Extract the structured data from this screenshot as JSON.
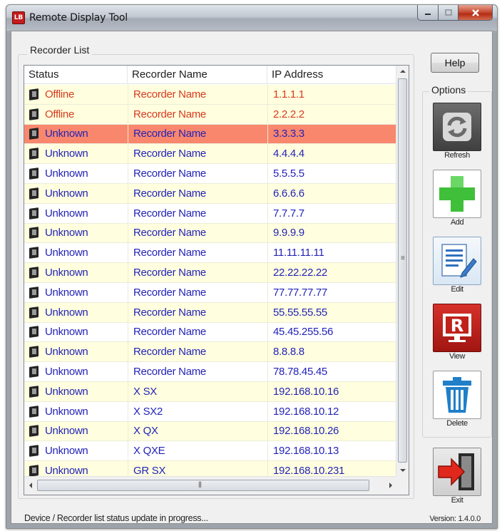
{
  "window": {
    "title": "Remote Display Tool",
    "app_icon_text": "LB"
  },
  "recorder_list": {
    "group_label": "Recorder List",
    "columns": [
      "Status",
      "Recorder Name",
      "IP Address"
    ],
    "rows": [
      {
        "status": "Offline",
        "name": "Recorder Name",
        "ip": "1.1.1.1",
        "state": "offline",
        "alt": true
      },
      {
        "status": "Offline",
        "name": "Recorder Name",
        "ip": "2.2.2.2",
        "state": "offline",
        "alt": true
      },
      {
        "status": "Unknown",
        "name": "Recorder Name",
        "ip": "3.3.3.3",
        "state": "unknown",
        "alt": false,
        "selected": true
      },
      {
        "status": "Unknown",
        "name": "Recorder Name",
        "ip": "4.4.4.4",
        "state": "unknown",
        "alt": true
      },
      {
        "status": "Unknown",
        "name": "Recorder Name",
        "ip": "5.5.5.5",
        "state": "unknown",
        "alt": false
      },
      {
        "status": "Unknown",
        "name": "Recorder Name",
        "ip": "6.6.6.6",
        "state": "unknown",
        "alt": true
      },
      {
        "status": "Unknown",
        "name": "Recorder Name",
        "ip": "7.7.7.7",
        "state": "unknown",
        "alt": false
      },
      {
        "status": "Unknown",
        "name": "Recorder Name",
        "ip": "9.9.9.9",
        "state": "unknown",
        "alt": true
      },
      {
        "status": "Unknown",
        "name": "Recorder Name",
        "ip": "11.11.11.11",
        "state": "unknown",
        "alt": false
      },
      {
        "status": "Unknown",
        "name": "Recorder Name",
        "ip": "22.22.22.22",
        "state": "unknown",
        "alt": true
      },
      {
        "status": "Unknown",
        "name": "Recorder Name",
        "ip": "77.77.77.77",
        "state": "unknown",
        "alt": false
      },
      {
        "status": "Unknown",
        "name": "Recorder Name",
        "ip": "55.55.55.55",
        "state": "unknown",
        "alt": true
      },
      {
        "status": "Unknown",
        "name": "Recorder Name",
        "ip": "45.45.255.56",
        "state": "unknown",
        "alt": false
      },
      {
        "status": "Unknown",
        "name": "Recorder Name",
        "ip": "8.8.8.8",
        "state": "unknown",
        "alt": true
      },
      {
        "status": "Unknown",
        "name": "Recorder Name",
        "ip": "78.78.45.45",
        "state": "unknown",
        "alt": false
      },
      {
        "status": "Unknown",
        "name": "X SX",
        "ip": "192.168.10.16",
        "state": "unknown",
        "alt": true
      },
      {
        "status": "Unknown",
        "name": "X SX2",
        "ip": "192.168.10.12",
        "state": "unknown",
        "alt": false
      },
      {
        "status": "Unknown",
        "name": "X QX",
        "ip": "192.168.10.26",
        "state": "unknown",
        "alt": true
      },
      {
        "status": "Unknown",
        "name": "X QXE",
        "ip": "192.168.10.13",
        "state": "unknown",
        "alt": false
      },
      {
        "status": "Unknown",
        "name": "GR SX",
        "ip": "192.168.10.231",
        "state": "unknown",
        "alt": true
      }
    ]
  },
  "toolbar": {
    "help_label": "Help",
    "options_label": "Options",
    "refresh_label": "Refresh",
    "add_label": "Add",
    "edit_label": "Edit",
    "view_label": "View",
    "delete_label": "Delete",
    "exit_label": "Exit"
  },
  "footer": {
    "status": "Device / Recorder list status update in progress...",
    "version": "Version: 1.4.0.0"
  },
  "colors": {
    "offline": "#d83a1e",
    "unknown": "#2323b8",
    "selected_row": "#f9876d",
    "alt_row": "#ffffdf"
  }
}
